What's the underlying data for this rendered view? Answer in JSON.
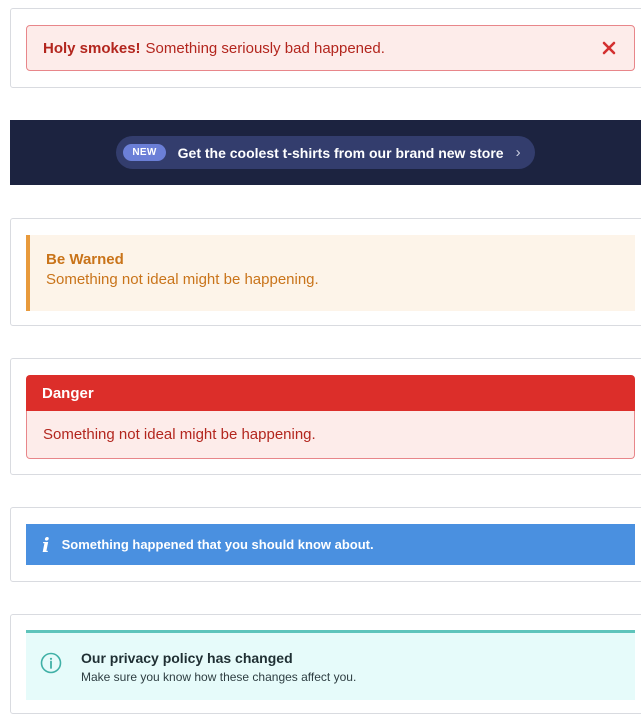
{
  "alert_error": {
    "strong": "Holy smokes!",
    "message": "Something seriously bad happened.",
    "close_label": "×"
  },
  "banner": {
    "badge": "NEW",
    "text": "Get the coolest t-shirts from our brand new store",
    "chevron": "›"
  },
  "alert_warning": {
    "title": "Be Warned",
    "message": "Something not ideal might be happening."
  },
  "alert_danger": {
    "title": "Danger",
    "message": "Something not ideal might be happening."
  },
  "alert_info": {
    "icon": "i",
    "message": "Something happened that you should know about."
  },
  "alert_privacy": {
    "title": "Our privacy policy has changed",
    "message": "Make sure you know how these changes affect you."
  },
  "colors": {
    "error": "#b3261e",
    "banner_bg": "#1c2340",
    "warning": "#e89a3c",
    "danger": "#dc2e2a",
    "info": "#4a90e0",
    "teal": "#5ec4bb"
  }
}
